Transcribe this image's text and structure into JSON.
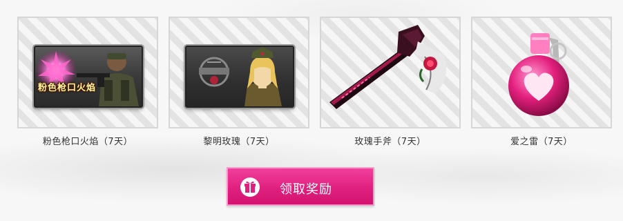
{
  "rewards": [
    {
      "name": "粉色枪口火焰（7天）",
      "image_text": "粉色枪口火焰",
      "icon": "soldier-card-icon"
    },
    {
      "name": "黎明玫瑰（7天）",
      "image_text": "",
      "icon": "rose-girl-card-icon"
    },
    {
      "name": "玫瑰手斧（7天）",
      "image_text": "",
      "icon": "rose-hatchet-icon"
    },
    {
      "name": "爱之雷（7天）",
      "image_text": "",
      "icon": "heart-grenade-icon"
    }
  ],
  "claim_button": {
    "label": "领取奖励",
    "icon": "gift-icon"
  },
  "colors": {
    "accent": "#e0207e",
    "button_border": "#f59ac9"
  }
}
